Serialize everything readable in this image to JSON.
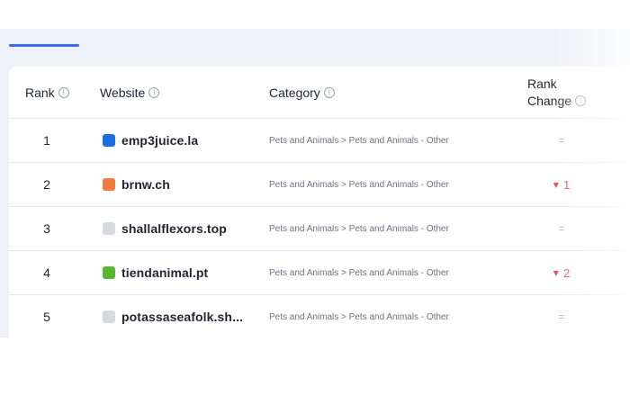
{
  "table": {
    "headers": {
      "rank": "Rank",
      "website": "Website",
      "category": "Category",
      "rank_change_line1": "Rank",
      "rank_change_line2": "Change"
    },
    "rows": [
      {
        "rank": "1",
        "site": "emp3juice.la",
        "category": "Pets and Animals > Pets and Animals - Other",
        "change": "=",
        "change_dir": "same",
        "favicon_color": "#1a6fe0"
      },
      {
        "rank": "2",
        "site": "brnw.ch",
        "category": "Pets and Animals > Pets and Animals - Other",
        "change": "1",
        "change_dir": "down",
        "favicon_color": "#f07b3f"
      },
      {
        "rank": "3",
        "site": "shallalflexors.top",
        "category": "Pets and Animals > Pets and Animals - Other",
        "change": "=",
        "change_dir": "same",
        "favicon_color": "#d5d9e2"
      },
      {
        "rank": "4",
        "site": "tiendanimal.pt",
        "category": "Pets and Animals > Pets and Animals - Other",
        "change": "2",
        "change_dir": "down",
        "favicon_color": "#58b52f"
      },
      {
        "rank": "5",
        "site": "potassaseafolk.sh...",
        "category": "Pets and Animals > Pets and Animals - Other",
        "change": "=",
        "change_dir": "same",
        "favicon_color": "#d5d9e2"
      }
    ]
  },
  "colors": {
    "accent": "#3b6cf0",
    "down": "#e5484d",
    "neutral": "#b0b6c3"
  },
  "icons": {
    "info": "info-circle-icon",
    "down_arrow": "triangle-down-icon"
  }
}
